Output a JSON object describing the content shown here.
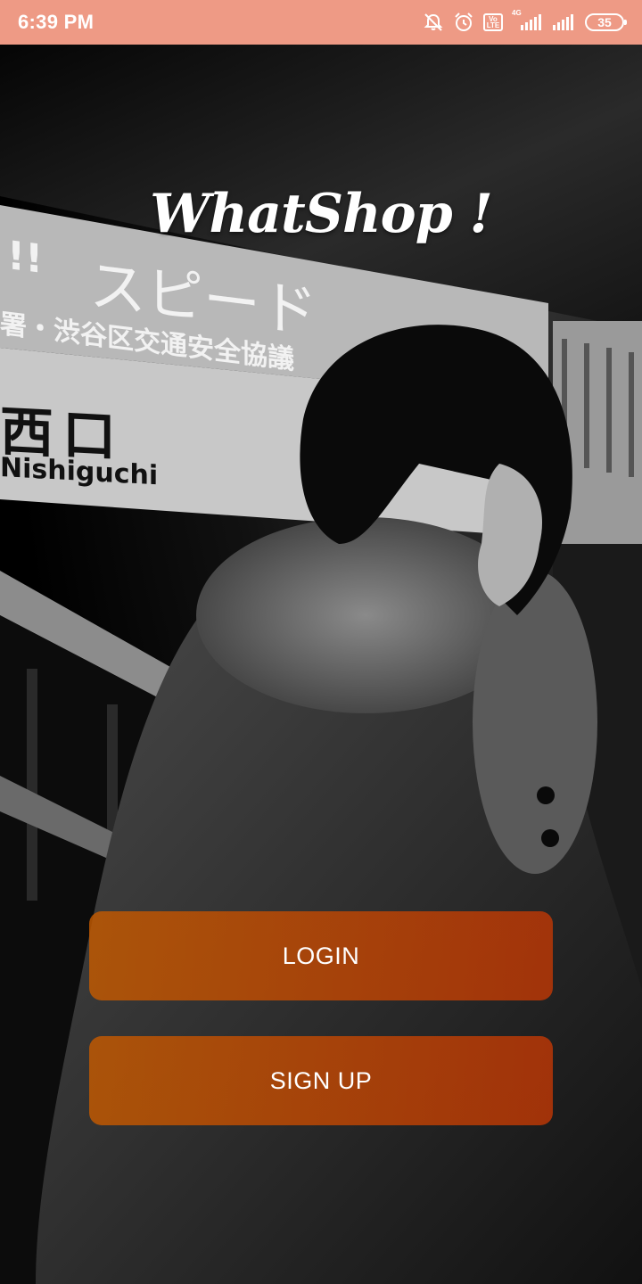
{
  "status_bar": {
    "time": "6:39 PM",
    "network_type": "4G",
    "volte_label": "Vo LTE",
    "battery_level": "35",
    "icons": [
      "mute-bell-icon",
      "alarm-icon",
      "volte-icon",
      "signal-4g-icon",
      "signal-icon",
      "battery-icon"
    ]
  },
  "background": {
    "sign_japanese_top": "スピード",
    "sign_japanese_mid": "署・渋谷区交通安全協議",
    "sign_exclaim": "!!",
    "sign_kanji": "西口",
    "sign_romaji": "Nishiguchi"
  },
  "app": {
    "title": "WhatShop !"
  },
  "buttons": {
    "login_label": "LOGIN",
    "signup_label": "SIGN UP"
  },
  "colors": {
    "status_bar": "#ee9a85",
    "button_start": "#c45a00",
    "button_end": "#be3705"
  }
}
